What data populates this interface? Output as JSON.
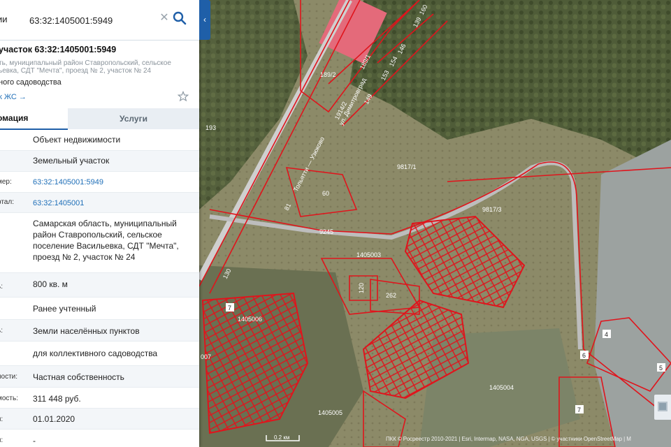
{
  "search": {
    "type_label": "ии",
    "query": "63:32:1405001:5949"
  },
  "object": {
    "title": "участок 63:32:1405001:5949",
    "address_short": "ть, муниципальный район Ставропольский, сельское\nьевка, СДТ \"Мечта\", проезд № 2, участок № 24",
    "usage_short": "ного садоводства",
    "link": "к ЖС →"
  },
  "tabs": {
    "info": "омация",
    "services": "Услуги"
  },
  "rows": [
    {
      "label": "",
      "value": "Объект недвижимости"
    },
    {
      "label": "",
      "value": "Земельный участок"
    },
    {
      "label": "мер:",
      "value": "63:32:1405001:5949",
      "link": true
    },
    {
      "label": "ртал:",
      "value": "63:32:1405001",
      "link": true
    },
    {
      "label": "",
      "value": "Самарская область, муниципальный район Ставропольский, сельское поселение Васильевка, СДТ \"Мечта\", проезд № 2, участок № 24"
    },
    {
      "label": "ь:",
      "value": "800 кв. м"
    },
    {
      "label": "",
      "value": "Ранее учтенный"
    },
    {
      "label": "ь:",
      "value": "Земли населённых пунктов"
    },
    {
      "label": "",
      "value": "для коллективного садоводства"
    },
    {
      "label": "ности:",
      "value": "Частная собственность"
    },
    {
      "label": "мость:",
      "value": "311 448 руб."
    },
    {
      "label": "я:",
      "value": "01.01.2020"
    },
    {
      "label": "я:",
      "value": "-"
    }
  ],
  "map": {
    "scale": "0.2 км",
    "attribution": "ПКК © Росреестр 2010-2021 | Esri, Intermap, NASA, NGA, USGS | © участники OpenStreetMap | М",
    "labels": [
      "160",
      "139",
      "146",
      "154",
      "153",
      "149",
      "189/1",
      "189/2",
      "193",
      "1914/2",
      "Тольятти — Узюково",
      "ул. Димитровград",
      "60",
      "81",
      "9245",
      "9817/1",
      "9817/3",
      "1405003",
      "120",
      "262",
      "1405006",
      "1405005",
      "1405004",
      "130",
      "7",
      "4",
      "6",
      "5",
      "7",
      "007"
    ],
    "colors": {
      "boundary": "#e0141c",
      "panel_accent": "#1f5fa8",
      "link": "#1f6fb8"
    }
  }
}
